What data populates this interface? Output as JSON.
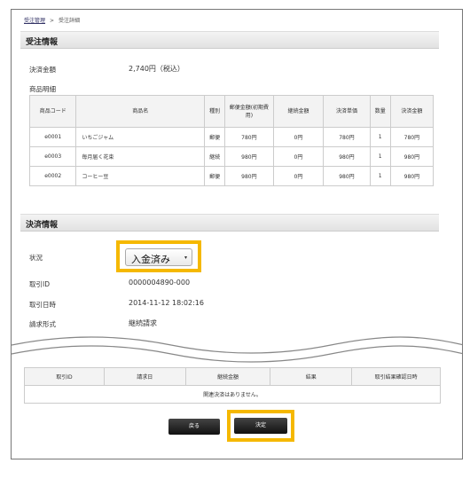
{
  "breadcrumb": {
    "parent": "受注管理",
    "separator": ">",
    "current": "受注詳細"
  },
  "order_section": {
    "title": "受注情報",
    "amount_label": "決済金額",
    "amount_value": "2,740円（税込）",
    "items_label": "商品明細",
    "columns": [
      "商品コード",
      "商品名",
      "種別",
      "郵便金額(初期費用)",
      "継続金額",
      "決済単価",
      "数量",
      "決済金額"
    ],
    "rows": [
      {
        "code": "e0001",
        "name": "いちごジャム",
        "type": "郵便",
        "postal": "780円",
        "recurring": "0円",
        "unit": "780円",
        "qty": "1",
        "total": "780円"
      },
      {
        "code": "e0003",
        "name": "毎月届く花束",
        "type": "継続",
        "postal": "980円",
        "recurring": "0円",
        "unit": "980円",
        "qty": "1",
        "total": "980円"
      },
      {
        "code": "e0002",
        "name": "コーヒー豆",
        "type": "郵便",
        "postal": "980円",
        "recurring": "0円",
        "unit": "980円",
        "qty": "1",
        "total": "980円"
      }
    ]
  },
  "payment_section": {
    "title": "決済情報",
    "status_label": "状況",
    "status_value": "入金済み",
    "txn_id_label": "取引ID",
    "txn_id_value": "0000004890-000",
    "txn_date_label": "取引日時",
    "txn_date_value": "2014-11-12 18:02:16",
    "billing_label": "請求形式",
    "billing_value": "継続請求"
  },
  "related_table": {
    "columns": [
      "取引ID",
      "請求日",
      "継続金額",
      "結果",
      "取引結果確認日時"
    ],
    "empty_message": "関連決済はありません。"
  },
  "buttons": {
    "back_label": "戻る",
    "confirm_label": "決定"
  },
  "colors": {
    "highlight": "#f5b800"
  }
}
